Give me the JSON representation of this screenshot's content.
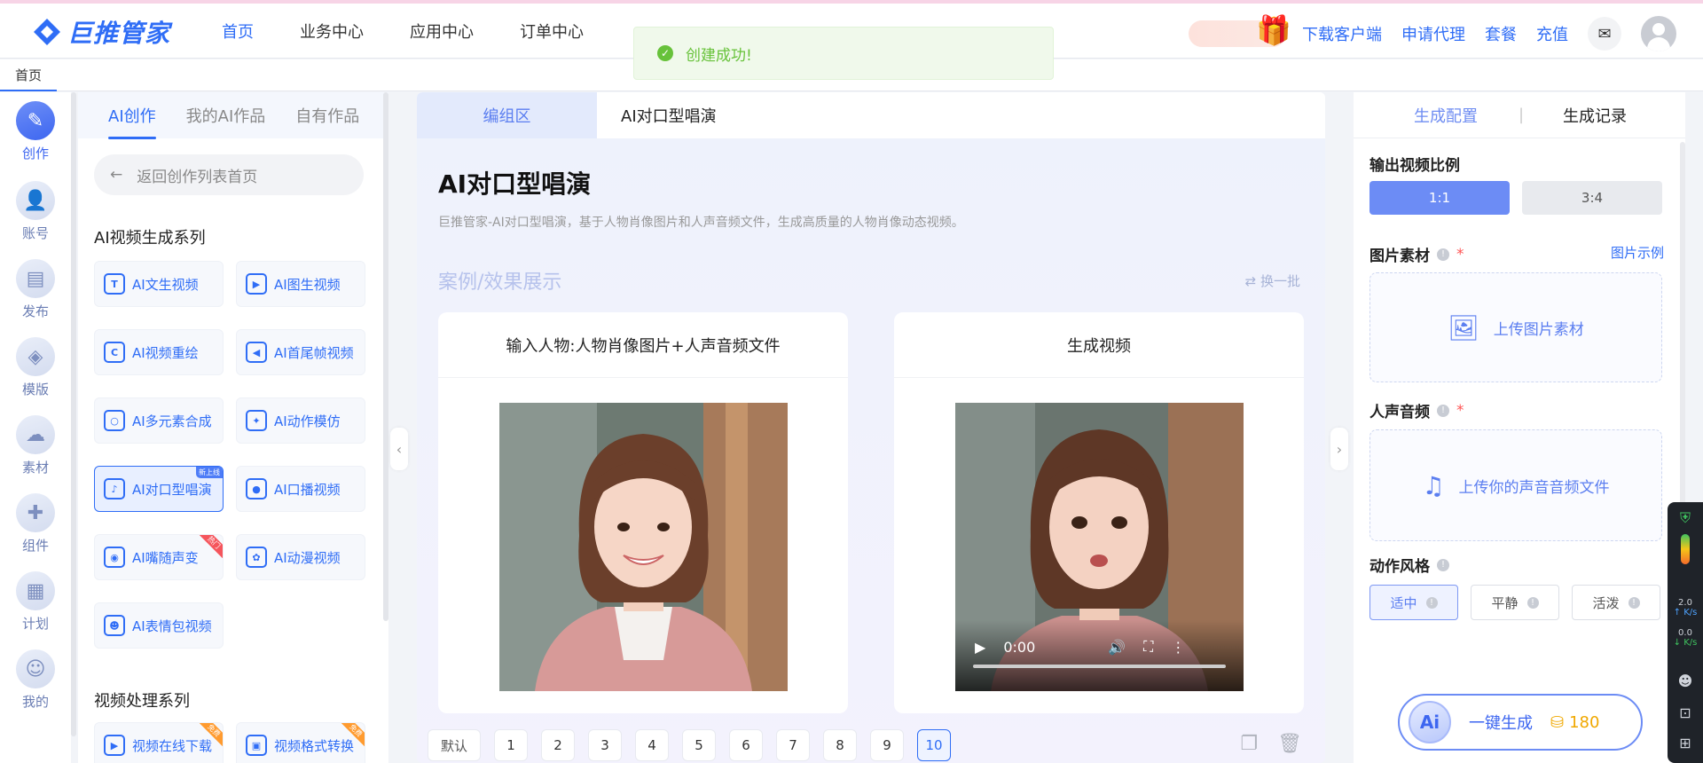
{
  "colors": {
    "accent": "#2f6df6",
    "success": "#67c23a",
    "coins": "#f0a800"
  },
  "header": {
    "logo_text": "巨推管家",
    "nav": [
      "首页",
      "业务中心",
      "应用中心",
      "订单中心"
    ],
    "right_links": [
      "下载客户端",
      "申请代理",
      "套餐",
      "充值"
    ]
  },
  "toast": {
    "message": "创建成功!"
  },
  "tabbar": {
    "home": "首页"
  },
  "leftnav": {
    "items": [
      "创作",
      "账号",
      "发布",
      "模版",
      "素材",
      "组件",
      "计划",
      "我的"
    ]
  },
  "leftpanel": {
    "tabs": [
      "AI创作",
      "我的AI作品",
      "自有作品"
    ],
    "back_label": "返回创作列表首页",
    "section1_title": "AI视频生成系列",
    "section1_items": [
      "AI文生视频",
      "AI图生视频",
      "AI视频重绘",
      "AI首尾帧视频",
      "AI多元素合成",
      "AI动作模仿",
      "AI对口型唱演",
      "AI口播视频",
      "AI嘴随声变",
      "AI动漫视频",
      "AI表情包视频"
    ],
    "badge_new": "新上线",
    "ribbon_hot": "热门",
    "section2_title": "视频处理系列",
    "section2_items": [
      "视频在线下载",
      "视频格式转换"
    ],
    "ribbon_free": "免费"
  },
  "main": {
    "tab_edit": "编组区",
    "tab_current": "AI对口型唱演",
    "title": "AI对口型唱演",
    "description": "巨推管家-AI对口型唱演，基于人物肖像图片和人声音频文件，生成高质量的人物肖像动态视频。",
    "case_title": "案例/效果展示",
    "swap_label": "换一批",
    "input_card_title": "输入人物:人物肖像图片+人声音频文件",
    "output_card_title": "生成视频",
    "video_time": "0:00",
    "pagination": {
      "default_label": "默认",
      "pages": [
        "1",
        "2",
        "3",
        "4",
        "5",
        "6",
        "7",
        "8",
        "9",
        "10"
      ],
      "active": "10"
    }
  },
  "rightpanel": {
    "tabs": [
      "生成配置",
      "生成记录"
    ],
    "ratio_label": "输出视频比例",
    "ratios": [
      "1:1",
      "3:4"
    ],
    "image_label": "图片素材",
    "image_example": "图片示例",
    "upload_image": "上传图片素材",
    "audio_label": "人声音频",
    "upload_audio": "上传你的声音音频文件",
    "style_label": "动作风格",
    "styles": [
      "适中",
      "平静",
      "活泼"
    ],
    "generate_label": "一键生成",
    "ai_badge": "Ai",
    "coins": "180"
  },
  "sidebar2": {
    "up_speed": "2.0",
    "up_unit": "K/s",
    "down_speed": "0.0",
    "down_unit": "K/s"
  }
}
